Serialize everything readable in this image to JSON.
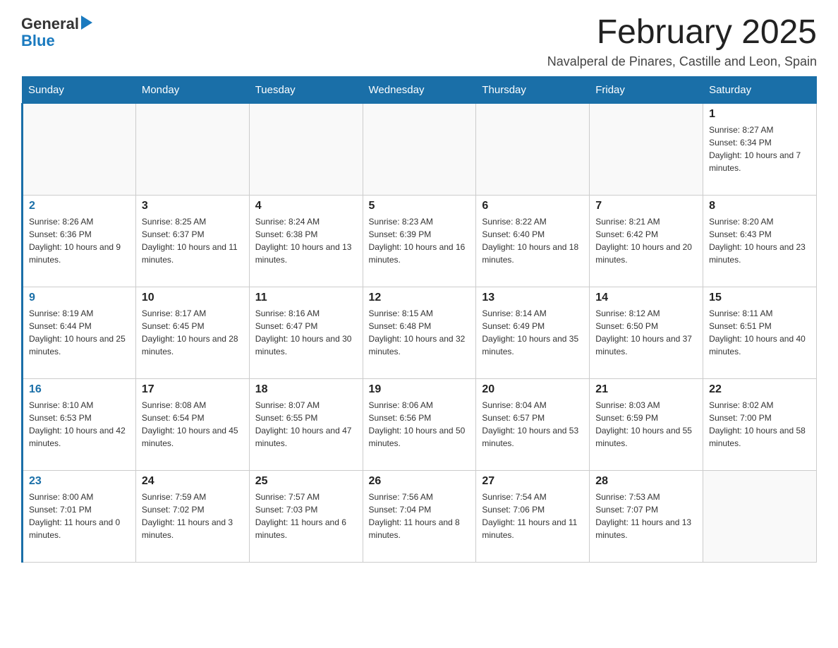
{
  "header": {
    "logo": {
      "line1": "General",
      "arrow_symbol": "▶",
      "line2": "Blue"
    },
    "title": "February 2025",
    "subtitle": "Navalperal de Pinares, Castille and Leon, Spain"
  },
  "days_of_week": [
    "Sunday",
    "Monday",
    "Tuesday",
    "Wednesday",
    "Thursday",
    "Friday",
    "Saturday"
  ],
  "weeks": [
    {
      "days": [
        {
          "number": "",
          "info": ""
        },
        {
          "number": "",
          "info": ""
        },
        {
          "number": "",
          "info": ""
        },
        {
          "number": "",
          "info": ""
        },
        {
          "number": "",
          "info": ""
        },
        {
          "number": "",
          "info": ""
        },
        {
          "number": "1",
          "info": "Sunrise: 8:27 AM\nSunset: 6:34 PM\nDaylight: 10 hours and 7 minutes."
        }
      ]
    },
    {
      "days": [
        {
          "number": "2",
          "info": "Sunrise: 8:26 AM\nSunset: 6:36 PM\nDaylight: 10 hours and 9 minutes."
        },
        {
          "number": "3",
          "info": "Sunrise: 8:25 AM\nSunset: 6:37 PM\nDaylight: 10 hours and 11 minutes."
        },
        {
          "number": "4",
          "info": "Sunrise: 8:24 AM\nSunset: 6:38 PM\nDaylight: 10 hours and 13 minutes."
        },
        {
          "number": "5",
          "info": "Sunrise: 8:23 AM\nSunset: 6:39 PM\nDaylight: 10 hours and 16 minutes."
        },
        {
          "number": "6",
          "info": "Sunrise: 8:22 AM\nSunset: 6:40 PM\nDaylight: 10 hours and 18 minutes."
        },
        {
          "number": "7",
          "info": "Sunrise: 8:21 AM\nSunset: 6:42 PM\nDaylight: 10 hours and 20 minutes."
        },
        {
          "number": "8",
          "info": "Sunrise: 8:20 AM\nSunset: 6:43 PM\nDaylight: 10 hours and 23 minutes."
        }
      ]
    },
    {
      "days": [
        {
          "number": "9",
          "info": "Sunrise: 8:19 AM\nSunset: 6:44 PM\nDaylight: 10 hours and 25 minutes."
        },
        {
          "number": "10",
          "info": "Sunrise: 8:17 AM\nSunset: 6:45 PM\nDaylight: 10 hours and 28 minutes."
        },
        {
          "number": "11",
          "info": "Sunrise: 8:16 AM\nSunset: 6:47 PM\nDaylight: 10 hours and 30 minutes."
        },
        {
          "number": "12",
          "info": "Sunrise: 8:15 AM\nSunset: 6:48 PM\nDaylight: 10 hours and 32 minutes."
        },
        {
          "number": "13",
          "info": "Sunrise: 8:14 AM\nSunset: 6:49 PM\nDaylight: 10 hours and 35 minutes."
        },
        {
          "number": "14",
          "info": "Sunrise: 8:12 AM\nSunset: 6:50 PM\nDaylight: 10 hours and 37 minutes."
        },
        {
          "number": "15",
          "info": "Sunrise: 8:11 AM\nSunset: 6:51 PM\nDaylight: 10 hours and 40 minutes."
        }
      ]
    },
    {
      "days": [
        {
          "number": "16",
          "info": "Sunrise: 8:10 AM\nSunset: 6:53 PM\nDaylight: 10 hours and 42 minutes."
        },
        {
          "number": "17",
          "info": "Sunrise: 8:08 AM\nSunset: 6:54 PM\nDaylight: 10 hours and 45 minutes."
        },
        {
          "number": "18",
          "info": "Sunrise: 8:07 AM\nSunset: 6:55 PM\nDaylight: 10 hours and 47 minutes."
        },
        {
          "number": "19",
          "info": "Sunrise: 8:06 AM\nSunset: 6:56 PM\nDaylight: 10 hours and 50 minutes."
        },
        {
          "number": "20",
          "info": "Sunrise: 8:04 AM\nSunset: 6:57 PM\nDaylight: 10 hours and 53 minutes."
        },
        {
          "number": "21",
          "info": "Sunrise: 8:03 AM\nSunset: 6:59 PM\nDaylight: 10 hours and 55 minutes."
        },
        {
          "number": "22",
          "info": "Sunrise: 8:02 AM\nSunset: 7:00 PM\nDaylight: 10 hours and 58 minutes."
        }
      ]
    },
    {
      "days": [
        {
          "number": "23",
          "info": "Sunrise: 8:00 AM\nSunset: 7:01 PM\nDaylight: 11 hours and 0 minutes."
        },
        {
          "number": "24",
          "info": "Sunrise: 7:59 AM\nSunset: 7:02 PM\nDaylight: 11 hours and 3 minutes."
        },
        {
          "number": "25",
          "info": "Sunrise: 7:57 AM\nSunset: 7:03 PM\nDaylight: 11 hours and 6 minutes."
        },
        {
          "number": "26",
          "info": "Sunrise: 7:56 AM\nSunset: 7:04 PM\nDaylight: 11 hours and 8 minutes."
        },
        {
          "number": "27",
          "info": "Sunrise: 7:54 AM\nSunset: 7:06 PM\nDaylight: 11 hours and 11 minutes."
        },
        {
          "number": "28",
          "info": "Sunrise: 7:53 AM\nSunset: 7:07 PM\nDaylight: 11 hours and 13 minutes."
        },
        {
          "number": "",
          "info": ""
        }
      ]
    }
  ]
}
